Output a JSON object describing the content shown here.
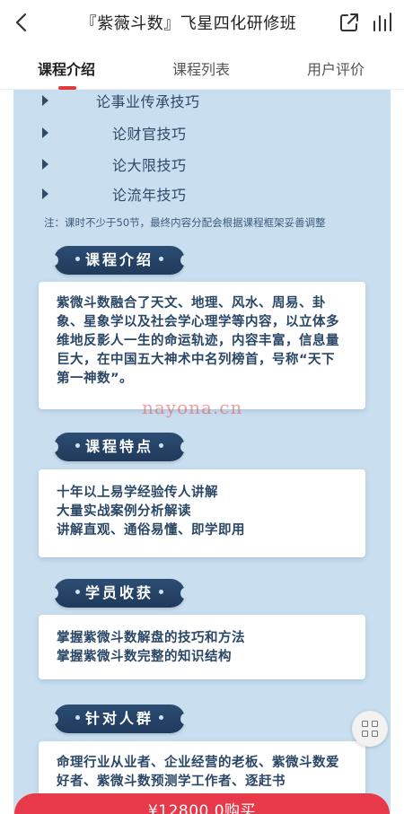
{
  "header": {
    "title": "『紫薇斗数』飞星四化研修班",
    "back_icon": "chevron-left-icon",
    "share_icon": "share-icon",
    "stats_icon": "bar-chart-icon"
  },
  "tabs": [
    {
      "label": "课程介绍",
      "active": true
    },
    {
      "label": "课程列表",
      "active": false
    },
    {
      "label": "用户评价",
      "active": false
    }
  ],
  "outline": [
    "论事业传承技巧",
    "论财官技巧",
    "论大限技巧",
    "论流年技巧"
  ],
  "note": "注：课时不少于50节，最终内容分配会根据课程框架妥善调整",
  "sections": [
    {
      "title": "课程介绍",
      "body": "紫微斗数融合了天文、地理、风水、周易、卦象、星象学以及社会学心理学等内容，以立体多维地反影人一生的命运轨迹，内容丰富，信息量巨大，在中国五大神术中名列榜首，号称“天下第一神数”。"
    },
    {
      "title": "课程特点",
      "lines": [
        "十年以上易学经验传人讲解",
        "大量实战案例分析解读",
        "讲解直观、通俗易懂、即学即用"
      ]
    },
    {
      "title": "学员收获",
      "lines": [
        "掌握紫微斗数解盘的技巧和方法",
        "掌握紫微斗数完整的知识结构"
      ]
    },
    {
      "title": "针对人群",
      "body": "命理行业从业者、企业经营的老板、紫微斗数爱好者、紫微斗数预测学工作者、逐赶书"
    }
  ],
  "watermark": "nayona.cn",
  "buy_button": "¥12800.0购买",
  "floating_icon": "grid-icon",
  "colors": {
    "accent": "#e8394a",
    "content_bg": "#c9dff0",
    "header_pill": "#2d4d73",
    "text_dark_blue": "#2b4766"
  }
}
